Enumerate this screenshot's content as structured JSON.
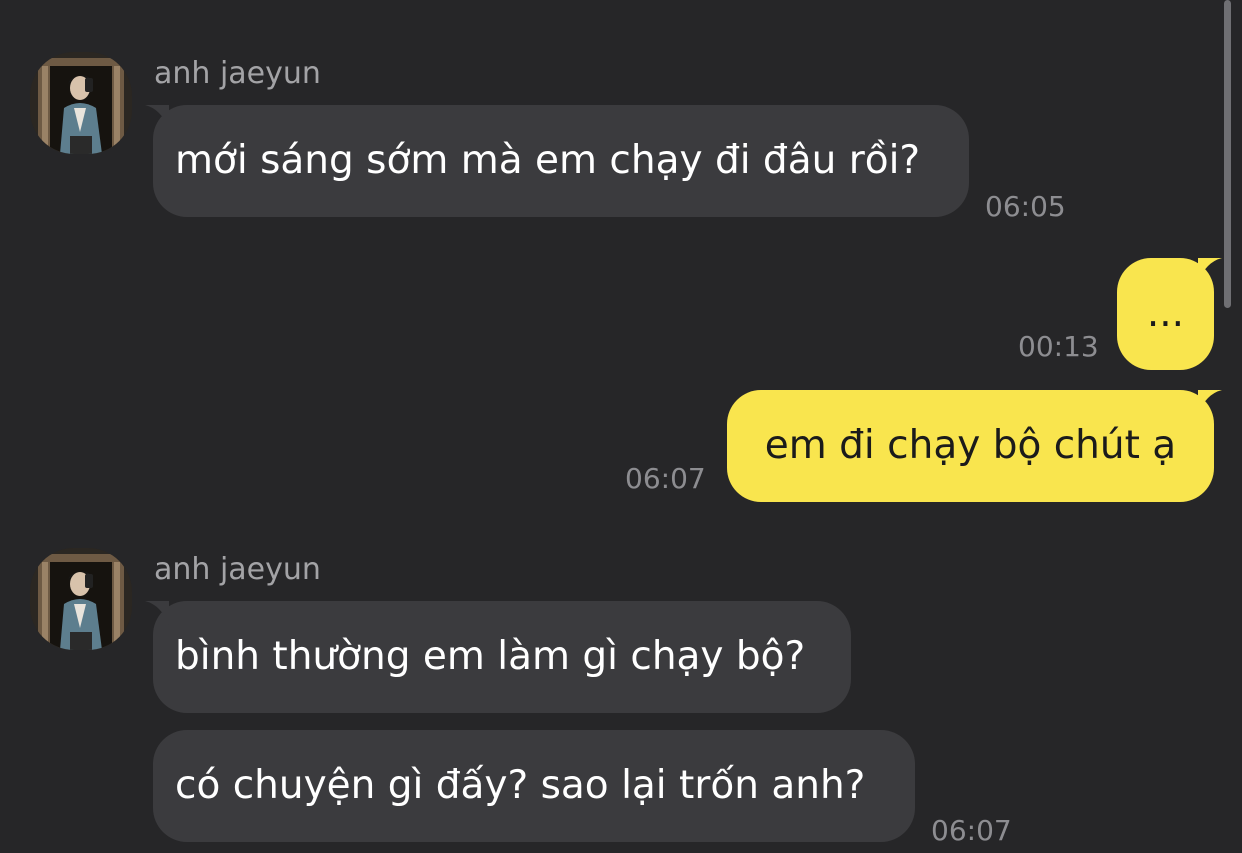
{
  "conversation": {
    "groups": [
      {
        "sender": "anh jaeyun",
        "messages": [
          {
            "text": "mới sáng sớm mà em chạy đi đâu rồi?",
            "time": "06:05"
          }
        ]
      },
      {
        "messages": [
          {
            "text": "...",
            "time": "00:13"
          },
          {
            "text": "em đi chạy bộ chút ạ",
            "time": "06:07"
          }
        ]
      },
      {
        "sender": "anh jaeyun",
        "messages": [
          {
            "text": "bình thường em làm gì chạy bộ?"
          },
          {
            "text": "có chuyện gì đấy? sao lại trốn anh?",
            "time": "06:07"
          }
        ]
      }
    ]
  },
  "colors": {
    "background": "#262628",
    "incoming_bubble": "#3b3b3e",
    "outgoing_bubble": "#f9e54e",
    "meta_text": "#8d8d91"
  }
}
